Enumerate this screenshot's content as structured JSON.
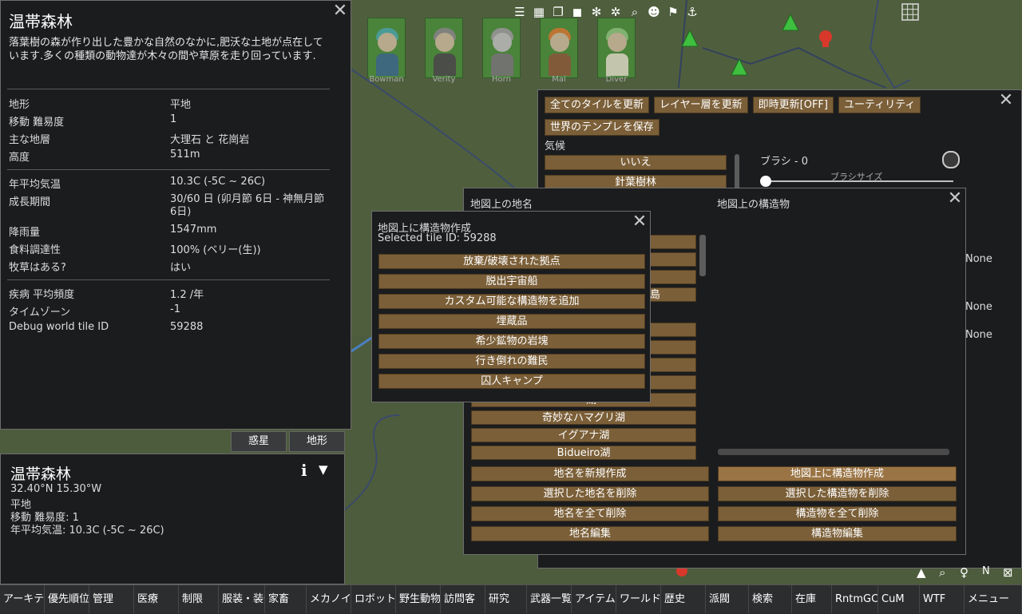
{
  "colors": {
    "accent_button": "#7b5f38",
    "panel": "#1b1c1e",
    "map_green": "#4a5a3a"
  },
  "topbar_icons": [
    "list-icon",
    "grid-icon",
    "copy-icon",
    "stack-icon",
    "snowflake-icon",
    "gear-icon",
    "search-icon",
    "skull-icon",
    "flag-icon",
    "anchor-icon"
  ],
  "colonists": [
    "Bowman",
    "Verity",
    "Horn",
    "Mal",
    "Diver"
  ],
  "tile_info": {
    "title": "温帯森林",
    "description": "落葉樹の森が作り出した豊かな自然のなかに,肥沃な土地が点在しています.多くの種類の動物達が木々の間や草原を走り回っています.",
    "rows1": [
      {
        "label": "地形",
        "value": "平地"
      },
      {
        "label": "移動 難易度",
        "value": "1"
      },
      {
        "label": "主な地層",
        "value": "大理石 と 花崗岩"
      },
      {
        "label": "高度",
        "value": "511m"
      }
    ],
    "rows2": [
      {
        "label": "年平均気温",
        "value": "10.3C (-5C ~ 26C)"
      },
      {
        "label": "成長期間",
        "value": "30/60 日 (卯月節 6日 - 神無月節 6日)"
      },
      {
        "label": "降雨量",
        "value": "1547mm"
      },
      {
        "label": "食料調達性",
        "value": "100% (ベリー(生))"
      },
      {
        "label": "牧草はある?",
        "value": "はい"
      }
    ],
    "rows3": [
      {
        "label": "疾病 平均頻度",
        "value": "1.2 /年"
      },
      {
        "label": "タイムゾーン",
        "value": "-1"
      },
      {
        "label": "Debug world tile ID",
        "value": "59288"
      }
    ],
    "tab_planet": "惑星",
    "tab_terrain": "地形"
  },
  "inspect": {
    "title": "温帯森林",
    "coords": "32.40°N 15.30°W",
    "terrain": "平地",
    "movement": "移動 難易度: 1",
    "temp": "年平均気温: 10.3C (-5C ~ 26C)"
  },
  "editor": {
    "btn_update_all": "全てのタイルを更新",
    "btn_update_layer": "レイヤー層を更新",
    "btn_instant": "即時更新[OFF]",
    "btn_utility": "ユーティリティ",
    "btn_save_template": "世界のテンプレを保存",
    "climate_label": "気候",
    "climate_items": [
      "いいえ",
      "針葉樹林"
    ],
    "brush_label": "ブラシ - 0",
    "brush_size_label": "ブラシサイズ",
    "none_labels": [
      "None",
      "None",
      "None"
    ]
  },
  "names_window": {
    "left_title": "地図上の地名",
    "right_title": "地図上の構造物",
    "list_items_hidden_partial": [
      "島",
      "湖"
    ],
    "list_items": [
      "奇妙なハマグリ湖",
      "イグアナ湖",
      "Bidueiro湖"
    ],
    "btn_new_name": "地名を新規作成",
    "btn_delete_selected_name": "選択した地名を削除",
    "btn_delete_all_names": "地名を全て削除",
    "btn_edit_names": "地名編集",
    "btn_create_structure": "地図上に構造物作成",
    "btn_delete_selected_structure": "選択した構造物を削除",
    "btn_delete_all_structures": "構造物を全て削除",
    "btn_edit_structures": "構造物編集"
  },
  "create_structure": {
    "title": "地図上に構造物作成",
    "selected": "Selected tile ID: 59288",
    "items": [
      "放棄/破壊された拠点",
      "脱出宇宙船",
      "カスタム可能な構造物を追加",
      "埋蔵品",
      "希少鉱物の岩塊",
      "行き倒れの難民",
      "囚人キャンプ"
    ]
  },
  "bottom_tabs": [
    "アーキテクト",
    "優先順位",
    "管理",
    "医療",
    "制限",
    "服装・装備",
    "家畜",
    "メカノイド",
    "ロボット",
    "野生動物",
    "訪問客",
    "研究",
    "武器一覧",
    "アイテム",
    "ワールド",
    "歴史",
    "派閥",
    "検索",
    "在庫",
    "RntmGC",
    "CuM",
    "WTF",
    "メニュー"
  ]
}
